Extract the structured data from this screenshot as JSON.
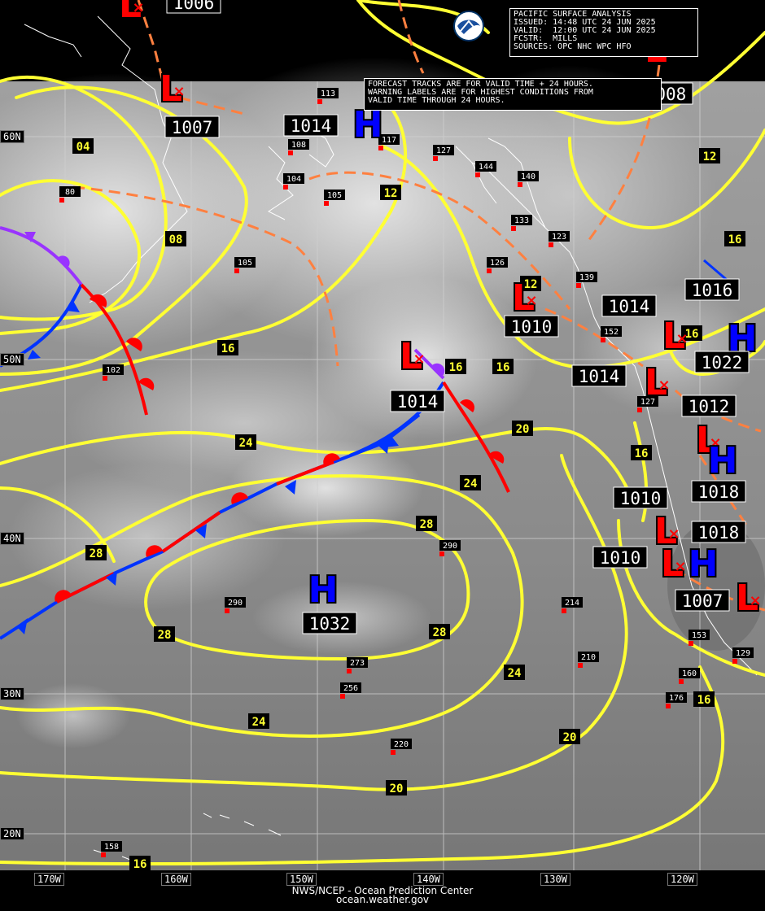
{
  "header": {
    "title": "PACIFIC SURFACE ANALYSIS",
    "issued": "ISSUED: 14:48 UTC 24 JUN 2025",
    "valid": "VALID:  12:00 UTC 24 JUN 2025",
    "forecaster": "FCSTR:  MILLS",
    "sources": "SOURCES: OPC NHC WPC HFO"
  },
  "note": {
    "line1": "FORECAST TRACKS ARE FOR VALID TIME + 24 HOURS.",
    "line2": "WARNING LABELS ARE FOR HIGHEST CONDITIONS FROM",
    "line3": "VALID TIME THROUGH 24 HOURS."
  },
  "credits": {
    "line1": "NWS/NCEP - Ocean Prediction Center",
    "line2": "ocean.weather.gov"
  },
  "lon_labels": [
    "170W",
    "160W",
    "150W",
    "140W",
    "130W",
    "120W"
  ],
  "lat_labels": [
    "60N",
    "50N",
    "40N",
    "30N",
    "20N"
  ],
  "pressure_centers": [
    {
      "type": "L",
      "pressure": "1006"
    },
    {
      "type": "L",
      "pressure": "1007"
    },
    {
      "type": "H",
      "pressure": "1014"
    },
    {
      "type": "L",
      "pressure": "1010"
    },
    {
      "type": "L",
      "pressure": "1014"
    },
    {
      "type": "H",
      "pressure": "1032"
    },
    {
      "type": "L",
      "pressure": "1014"
    },
    {
      "type": "H",
      "pressure": "1016"
    },
    {
      "type": "H",
      "pressure": "1022"
    },
    {
      "type": "L",
      "pressure": "1012"
    },
    {
      "type": "H",
      "pressure": "1018"
    },
    {
      "type": "L",
      "pressure": "1010"
    },
    {
      "type": "H",
      "pressure": "1018"
    },
    {
      "type": "L",
      "pressure": "1010"
    },
    {
      "type": "L",
      "pressure": "1007"
    },
    {
      "type": "L",
      "pressure": "1014"
    },
    {
      "type": "L",
      "pressure": "1008"
    }
  ],
  "isobar_labels": [
    "04",
    "08",
    "12",
    "12",
    "12",
    "16",
    "16",
    "16",
    "16",
    "16",
    "16",
    "16",
    "16",
    "20",
    "20",
    "20",
    "24",
    "24",
    "24",
    "24",
    "28",
    "28",
    "28",
    "28"
  ],
  "station_labels": [
    "113",
    "108",
    "117",
    "127",
    "144",
    "140",
    "104",
    "105",
    "133",
    "123",
    "105",
    "126",
    "139",
    "80",
    "102",
    "152",
    "127",
    "290",
    "290",
    "214",
    "210",
    "273",
    "256",
    "220",
    "176",
    "153",
    "160",
    "129",
    "158"
  ],
  "colors": {
    "isobar": "#ffff33",
    "low": "#ff0000",
    "high": "#0000ff",
    "cold_front": "#0033ff",
    "warm_front": "#ff0000",
    "occluded_front": "#9933ff",
    "track": "#ff8040",
    "land_outline": "#ffffff",
    "ocean_imagery": "#8c8c8c"
  }
}
